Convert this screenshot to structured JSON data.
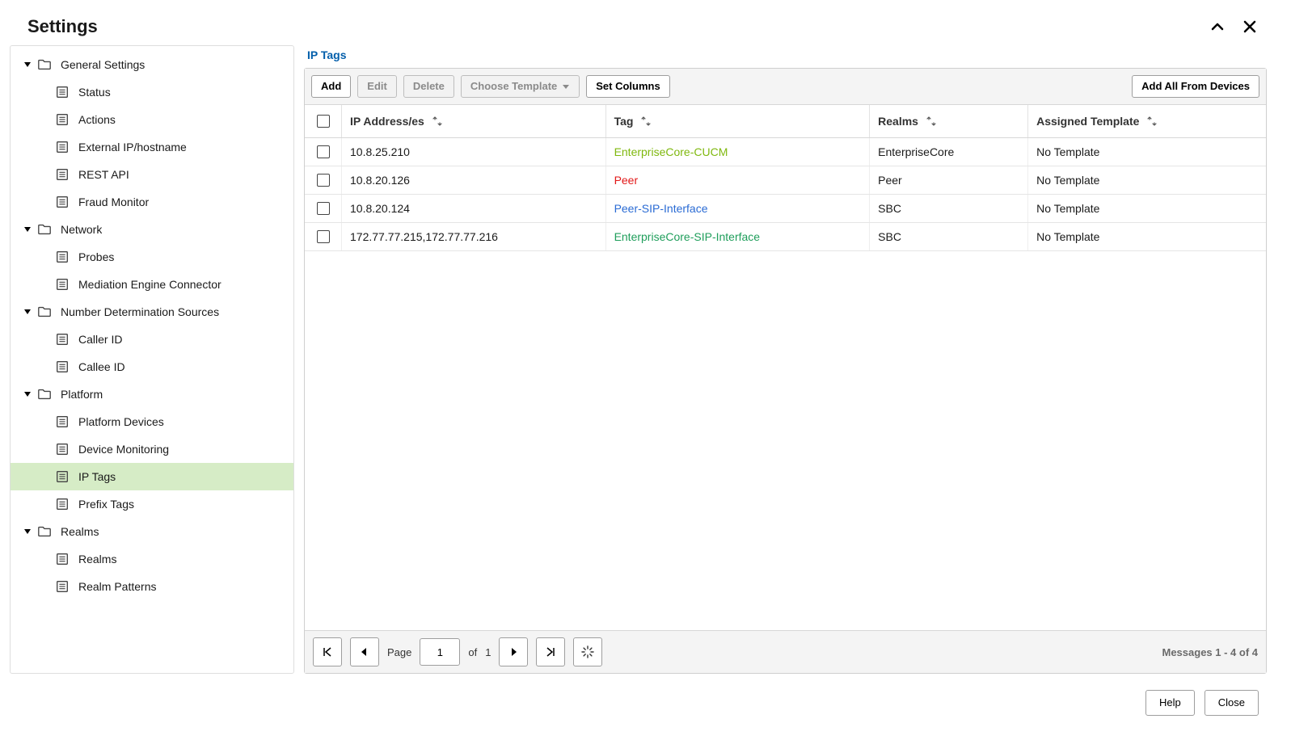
{
  "header": {
    "title": "Settings"
  },
  "sidebar": {
    "groups": [
      {
        "label": "General Settings",
        "items": [
          {
            "label": "Status"
          },
          {
            "label": "Actions"
          },
          {
            "label": "External IP/hostname"
          },
          {
            "label": "REST API"
          },
          {
            "label": "Fraud Monitor"
          }
        ]
      },
      {
        "label": "Network",
        "items": [
          {
            "label": "Probes"
          },
          {
            "label": "Mediation Engine Connector"
          }
        ]
      },
      {
        "label": "Number Determination Sources",
        "items": [
          {
            "label": "Caller ID"
          },
          {
            "label": "Callee ID"
          }
        ]
      },
      {
        "label": "Platform",
        "items": [
          {
            "label": "Platform Devices"
          },
          {
            "label": "Device Monitoring"
          },
          {
            "label": "IP Tags",
            "selected": true
          },
          {
            "label": "Prefix Tags"
          }
        ]
      },
      {
        "label": "Realms",
        "items": [
          {
            "label": "Realms"
          },
          {
            "label": "Realm Patterns"
          }
        ]
      }
    ]
  },
  "main": {
    "title": "IP Tags",
    "toolbar": {
      "add": "Add",
      "edit": "Edit",
      "delete": "Delete",
      "choose_template": "Choose Template",
      "set_columns": "Set Columns",
      "add_all": "Add All From Devices"
    },
    "columns": {
      "ip": "IP Address/es",
      "tag": "Tag",
      "realms": "Realms",
      "template": "Assigned Template"
    },
    "rows": [
      {
        "ip": "10.8.25.210",
        "tag": "EnterpriseCore-CUCM",
        "tagClass": "tag-EnterpriseCore-CUCM",
        "realms": "EnterpriseCore",
        "template": "No Template"
      },
      {
        "ip": "10.8.20.126",
        "tag": "Peer",
        "tagClass": "tag-Peer",
        "realms": "Peer",
        "template": "No Template"
      },
      {
        "ip": "10.8.20.124",
        "tag": "Peer-SIP-Interface",
        "tagClass": "tag-Peer-SIP-Interface",
        "realms": "SBC",
        "template": "No Template"
      },
      {
        "ip": "172.77.77.215,172.77.77.216",
        "tag": "EnterpriseCore-SIP-Interface",
        "tagClass": "tag-EnterpriseCore-SIP-Interface",
        "realms": "SBC",
        "template": "No Template"
      }
    ],
    "pager": {
      "page_label": "Page",
      "page_value": "1",
      "of_label": "of",
      "total_pages": "1",
      "messages": "Messages 1 - 4 of 4"
    }
  },
  "footer": {
    "help": "Help",
    "close": "Close"
  }
}
